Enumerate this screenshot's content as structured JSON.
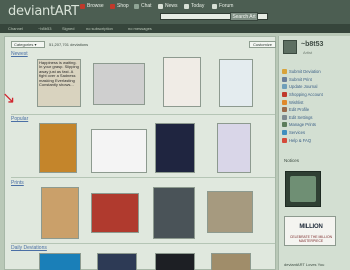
{
  "app": {
    "logo": "deviantART"
  },
  "topnav": [
    {
      "label": "Browse",
      "color": "#c0392b"
    },
    {
      "label": "Shop",
      "color": "#c0392b"
    },
    {
      "label": "Chat",
      "color": "#8fa495"
    },
    {
      "label": "News",
      "color": "#d7dfd5"
    },
    {
      "label": "Today",
      "color": "#d7dfd5"
    },
    {
      "label": "Forum",
      "color": "#d7dfd5"
    }
  ],
  "search": {
    "placeholder": "",
    "button_label": "Search Art"
  },
  "subbar": {
    "items": [
      "Channel",
      "~b8b53",
      "Signed",
      "no subscription",
      "no messages"
    ]
  },
  "main": {
    "categories_label": "Categories",
    "deviation_count": "51,207,701 deviations",
    "customize_label": "Customize",
    "sections": [
      {
        "title": "Newest",
        "thumb_colors": [
          "#d9d3bf",
          "#cfcfcf",
          "#f0ece6",
          "#e4ecef"
        ]
      },
      {
        "title": "Popular",
        "thumb_colors": [
          "#c4852b",
          "#f4f4f4",
          "#1f2540",
          "#d9d6e8"
        ]
      },
      {
        "title": "Prints",
        "thumb_colors": [
          "#caa06a",
          "#b03a2e",
          "#4a5358",
          "#a69a7f"
        ]
      },
      {
        "title": "Daily Deviations",
        "thumb_colors": [
          "#1a7fb8",
          "#2d3a55",
          "#1d1f24",
          "#a08d6a"
        ]
      }
    ],
    "newest_text": "Happiness is waiting. In your grasp. Slipping away just as fast. A fight over a Sadness masking Everlasting Constantly shows..."
  },
  "sidebar": {
    "username": "~b8t53",
    "usertype": "Artist",
    "menu": [
      {
        "label": "Submit Deviation",
        "color": "#d9a33a"
      },
      {
        "label": "Submit Print",
        "color": "#6b7f9a"
      },
      {
        "label": "Update Journal",
        "color": "#6f9fb9"
      },
      {
        "label": "Shopping Account",
        "color": "#c0392b"
      },
      {
        "label": "Wishlist",
        "color": "#e08a2b"
      },
      {
        "label": "Edit Profile",
        "color": "#9b6b4a"
      },
      {
        "label": "Edit Settings",
        "color": "#7e8a8e"
      },
      {
        "label": "Manage Prints",
        "color": "#5c7d5a"
      },
      {
        "label": "Services",
        "color": "#3f8fbf"
      },
      {
        "label": "Help & FAQ",
        "color": "#d44a3a"
      }
    ],
    "notices_label": "Notices",
    "ad_text": "MILLION",
    "ad_subtext": "CELEBRATE THE MILLION MASTERPIECE",
    "loves_label": "deviantART Loves You"
  }
}
